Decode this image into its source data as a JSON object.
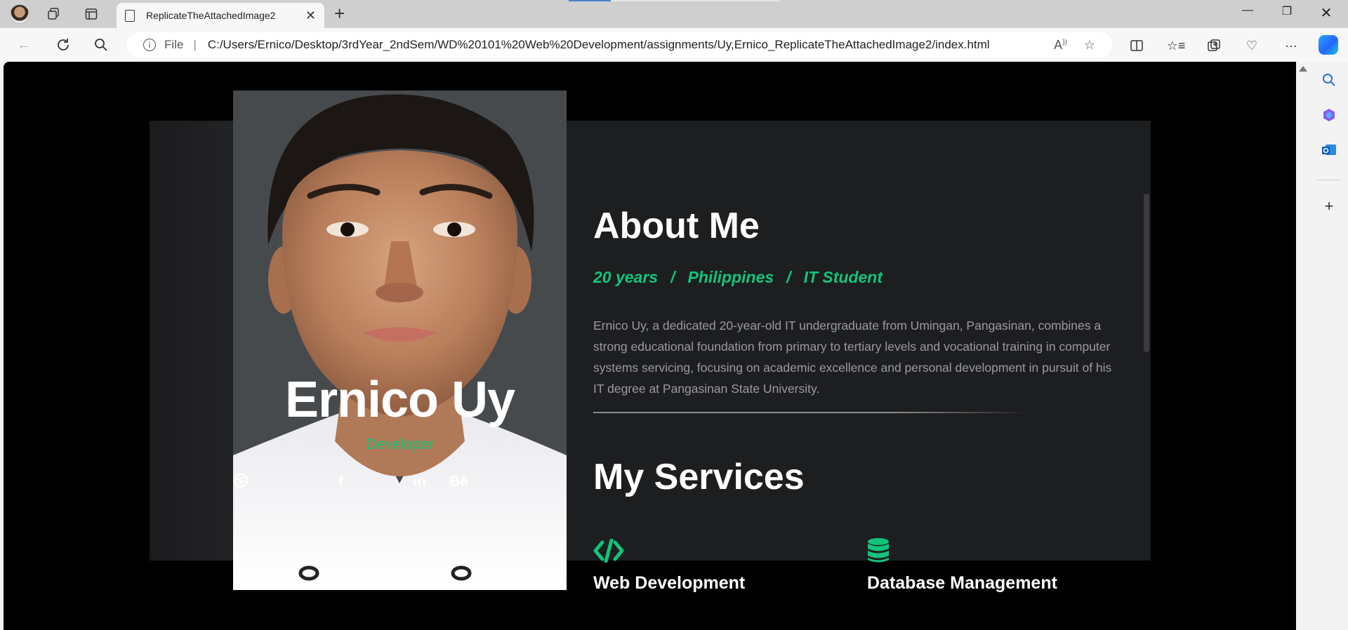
{
  "browser": {
    "tab_title": "ReplicateTheAttachedImage2",
    "url_scheme": "File",
    "url_path": "C:/Users/Ernico/Desktop/3rdYear_2ndSem/WD%20101%20Web%20Development/assignments/Uy,Ernico_ReplicateTheAttachedImage2/index.html"
  },
  "profile": {
    "name": "Ernico Uy",
    "role": "Developer",
    "socials": [
      {
        "icon": "facebook-icon",
        "glyph": "f"
      },
      {
        "icon": "dribbble-icon",
        "glyph": ""
      },
      {
        "icon": "linkedin-icon",
        "glyph": "in"
      },
      {
        "icon": "behance-icon",
        "glyph": "Bē"
      }
    ]
  },
  "about": {
    "heading": "About Me",
    "meta": [
      "20 years",
      "Philippines",
      "IT Student"
    ],
    "meta_sep": "/",
    "bio": "Ernico Uy, a dedicated 20-year-old IT undergraduate from Umingan, Pangasinan, combines a strong educational foundation from primary to tertiary levels and vocational training in computer systems servicing, focusing on academic excellence and personal development in pursuit of his IT degree at Pangasinan State University."
  },
  "services": {
    "heading": "My Services",
    "items": [
      {
        "label": "Web Development",
        "icon": "code-icon"
      },
      {
        "label": "Database Management",
        "icon": "database-icon"
      }
    ]
  },
  "colors": {
    "accent": "#12c47a",
    "card_bg": "#1d1e20",
    "page_bg": "#000000"
  }
}
